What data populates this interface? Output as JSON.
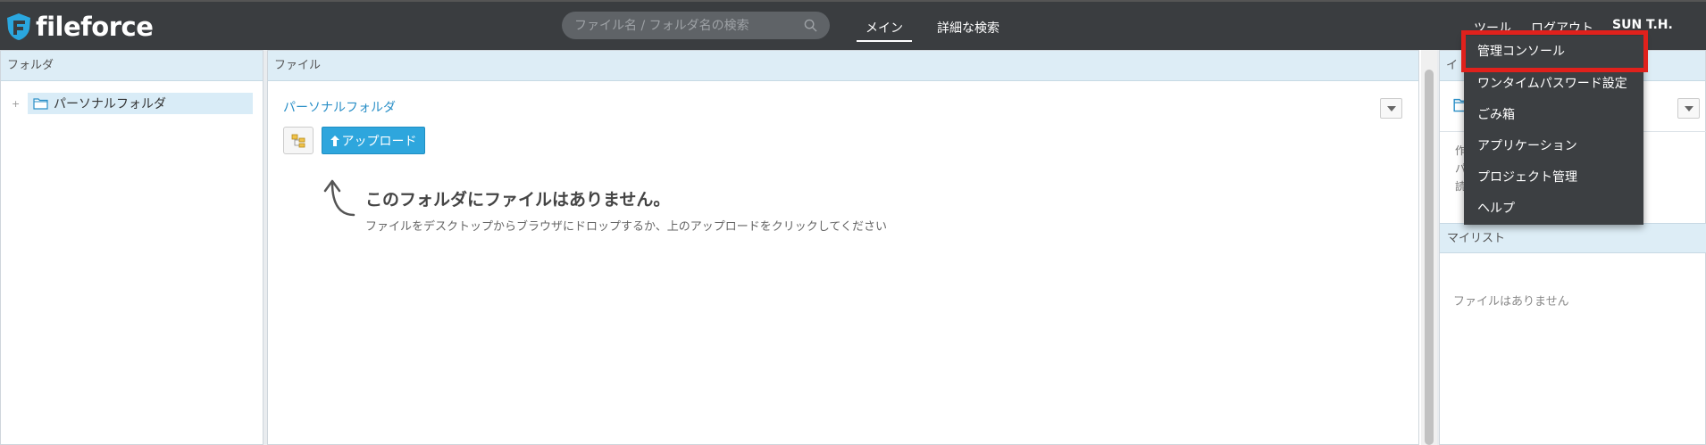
{
  "app": {
    "logo_text": "fileforce"
  },
  "search": {
    "placeholder": "ファイル名 / フォルダ名の検索"
  },
  "nav": {
    "main": "メイン",
    "advanced_search": "詳細な検索"
  },
  "header": {
    "tools": "ツール",
    "logout": "ログアウト",
    "user": "SUN T.H."
  },
  "tools_menu": {
    "items": [
      "管理コンソール",
      "ワンタイムパスワード設定",
      "ごみ箱",
      "アプリケーション",
      "プロジェクト管理",
      "ヘルプ"
    ]
  },
  "left_panel": {
    "title": "フォルダ",
    "tree": [
      {
        "toggle": "+",
        "label": "パーソナルフォルダ"
      }
    ]
  },
  "mid_panel": {
    "title": "ファイル",
    "breadcrumb": "パーソナルフォルダ",
    "upload_label": "アップロード",
    "empty_title": "このフォルダにファイルはありません。",
    "empty_sub": "ファイルをデスクトップからブラウザにドロップするか、上のアップロードをクリックしてください"
  },
  "right_panel": {
    "title_partial": "イ",
    "meta": [
      "作",
      "パ",
      "読"
    ],
    "mylist_title": "マイリスト",
    "mylist_empty": "ファイルはありません"
  },
  "colors": {
    "topbar": "#3a3d40",
    "accent": "#2ea6dd",
    "highlight": "#e0211c",
    "panel_head": "#ddedf6"
  }
}
